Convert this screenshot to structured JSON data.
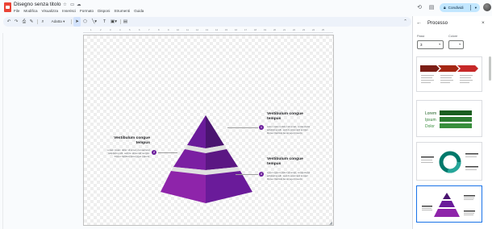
{
  "header": {
    "title": "Disegno senza titolo",
    "share_label": "Condividi",
    "menu": [
      "File",
      "Modifica",
      "Visualizza",
      "Inserisci",
      "Formato",
      "Disponi",
      "Strumenti",
      "Guida"
    ]
  },
  "toolbar": {
    "zoom_label": "Adatta"
  },
  "ruler": {
    "ticks": [
      "1",
      "2",
      "3",
      "4",
      "5",
      "6",
      "7",
      "8",
      "9",
      "10",
      "11",
      "12",
      "13",
      "14",
      "15",
      "16",
      "17",
      "18",
      "19",
      "20",
      "21",
      "22",
      "23",
      "24",
      "25"
    ]
  },
  "canvas": {
    "callouts": [
      {
        "number": "1",
        "title": "Vestibulum congue tempus",
        "body": "Lorem ipsum dolor sit amet, consectetur adipiscing elit, sed do eiusmod tempor. Donec facilisis lacus eget mauris."
      },
      {
        "number": "2",
        "title": "Vestibulum congue tempus",
        "body": "Lorem ipsum dolor sit amet, consectetur adipiscing elit, sed do eiusmod tempor. Donec facilisis lacus eget mauris."
      },
      {
        "number": "3",
        "title": "Vestibulum congue tempus",
        "body": "Lorem ipsum dolor sit amet, consectetur adipiscing elit, sed do eiusmod tempor. Donec facilisis lacus eget mauris."
      }
    ],
    "colors": {
      "pyramid_dark": "#4a1470",
      "pyramid_mid": "#6a1b9a",
      "pyramid_light": "#8e24aa",
      "band": "#e0e0e0"
    }
  },
  "panel": {
    "title": "Processo",
    "fields": [
      {
        "label": "Passi",
        "value": "3"
      },
      {
        "label": "Colore",
        "value": ""
      }
    ],
    "thumb_words": [
      "Lorem",
      "Ipsum",
      "Dolor"
    ]
  }
}
